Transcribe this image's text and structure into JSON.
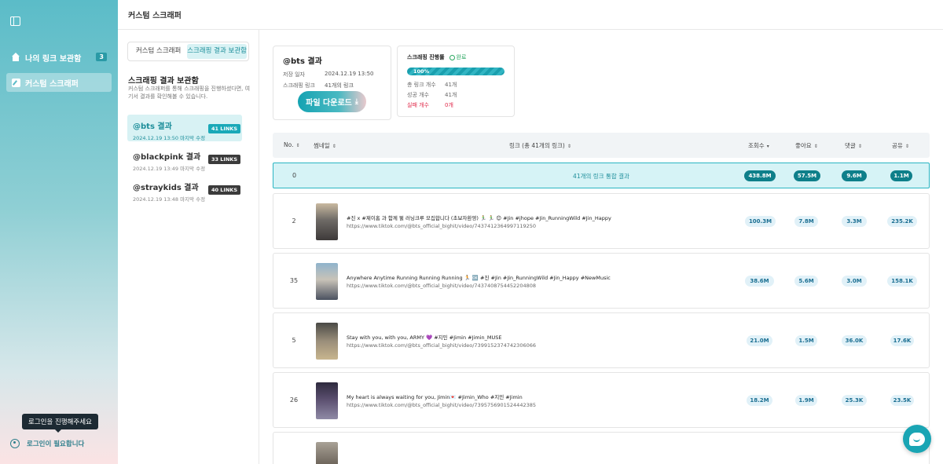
{
  "sidebar": {
    "items": [
      {
        "label": "나의 링크 보관함",
        "count": "3",
        "icon": "house-icon"
      },
      {
        "label": "커스텀 스크래퍼",
        "icon": "pencil-icon"
      }
    ],
    "tooltip": "로그인을 진행해주세요",
    "login_label": "로그인이 필요합니다"
  },
  "header": {
    "title": "커스텀 스크래퍼"
  },
  "middle": {
    "tabs": [
      "커스텀 스크래퍼",
      "스크래핑 결과 보관함"
    ],
    "title": "스크래핑 결과 보관함",
    "description": "커스텀 스크래퍼를 통해 스크래핑을 진행하셨다면, 여기서 결과를 확인해볼 수 있습니다.",
    "results": [
      {
        "name": "@bts 결과",
        "date": "2024.12.19 13:50 마지막 수정",
        "links": "41 LINKS"
      },
      {
        "name": "@blackpink 결과",
        "date": "2024.12.19 13:49 마지막 수정",
        "links": "33 LINKS"
      },
      {
        "name": "@straykids 결과",
        "date": "2024.12.19 13:48 마지막 수정",
        "links": "40 LINKS"
      }
    ]
  },
  "summary": {
    "title": "@bts 결과",
    "saved_label": "저장 일자",
    "saved_value": "2024.12.19 13:50",
    "link_label": "스크래핑 링크",
    "link_value": "41개의 링크",
    "download_label": "파일 다운로드"
  },
  "progress": {
    "title": "스크래핑 진행률",
    "status": "완료",
    "percent_label": "100%",
    "percent": 100,
    "stats": [
      {
        "label": "총 링크 개수",
        "value": "41개"
      },
      {
        "label": "성공 개수",
        "value": "41개"
      },
      {
        "label": "실패 개수",
        "value": "0개"
      }
    ]
  },
  "table": {
    "headers": {
      "no": "No.",
      "thumb": "썸네일",
      "link": "링크 (총 41개의 링크)",
      "views": "조회수",
      "likes": "좋아요",
      "comments": "댓글",
      "shares": "공유"
    },
    "total": {
      "no": "0",
      "label": "41개의 링크 통합 결과",
      "views": "438.8M",
      "likes": "57.5M",
      "comments": "9.6M",
      "shares": "1.1M"
    },
    "rows": [
      {
        "no": "2",
        "caption": "#진 x #제이홉 과 함께 뛸 러닝크루 모집합니다 (초보자환영) 🏃‍♂️ 🏃‍♂️ 😊 #Jin #jhope #Jin_RunningWild #Jin_Happy",
        "url": "https://www.tiktok.com/@bts_official_bighit/video/7437412364997119250",
        "views": "100.3M",
        "likes": "7.8M",
        "comments": "3.3M",
        "shares": "235.2K"
      },
      {
        "no": "35",
        "caption": "Anywhere Anytime Running Running Running 🏃 🆗 #진 #Jin #Jin_RunningWild #Jin_Happy #NewMusic",
        "url": "https://www.tiktok.com/@bts_official_bighit/video/7437408754452204808",
        "views": "38.6M",
        "likes": "5.6M",
        "comments": "3.0M",
        "shares": "158.1K"
      },
      {
        "no": "5",
        "caption": "Stay with you, with you, ARMY 💜 #지민 #Jimin #Jimin_MUSE",
        "url": "https://www.tiktok.com/@bts_official_bighit/video/7399152374742306066",
        "views": "21.0M",
        "likes": "1.5M",
        "comments": "36.0K",
        "shares": "17.6K"
      },
      {
        "no": "26",
        "caption": "My heart is always waiting for you, Jimin💌 #Jimin_Who #지민 #Jimin",
        "url": "https://www.tiktok.com/@bts_official_bighit/video/7395756901524442385",
        "views": "18.2M",
        "likes": "1.9M",
        "comments": "25.3K",
        "shares": "23.5K"
      }
    ]
  },
  "colors": {
    "accent": "#1aa5b4",
    "fail": "#e02a4a",
    "done": "#2aa760"
  }
}
